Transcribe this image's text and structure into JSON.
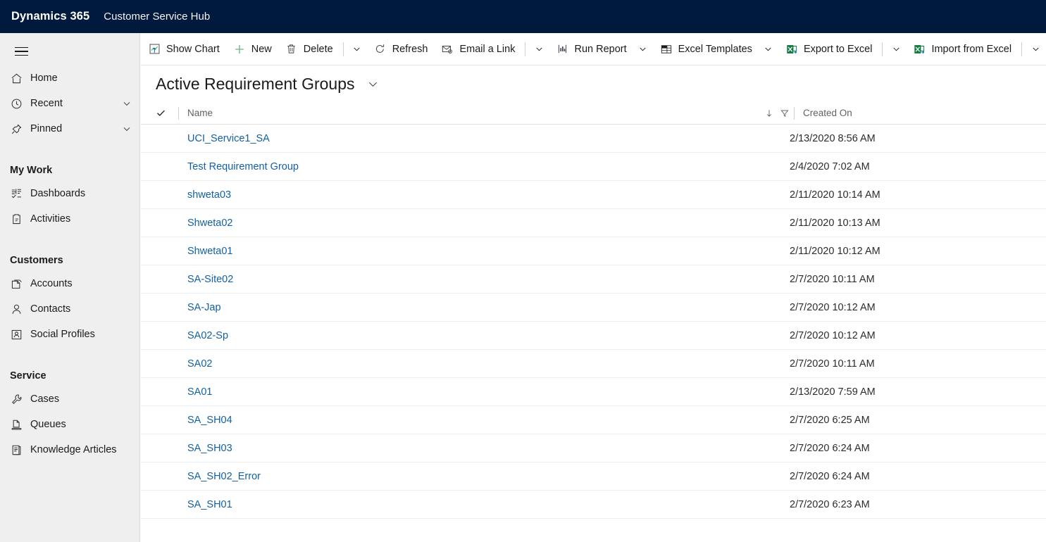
{
  "header": {
    "brand": "Dynamics 365",
    "app_name": "Customer Service Hub",
    "background_color": "#001a3d"
  },
  "sidebar": {
    "menu_toggle": "site-map-toggle",
    "top_items": [
      {
        "label": "Home",
        "icon": "home-icon",
        "expandable": false
      },
      {
        "label": "Recent",
        "icon": "clock-icon",
        "expandable": true
      },
      {
        "label": "Pinned",
        "icon": "pin-icon",
        "expandable": true
      }
    ],
    "groups": [
      {
        "title": "My Work",
        "items": [
          {
            "label": "Dashboards",
            "icon": "dashboard-icon"
          },
          {
            "label": "Activities",
            "icon": "activities-icon"
          }
        ]
      },
      {
        "title": "Customers",
        "items": [
          {
            "label": "Accounts",
            "icon": "accounts-icon"
          },
          {
            "label": "Contacts",
            "icon": "contact-icon"
          },
          {
            "label": "Social Profiles",
            "icon": "social-profile-icon"
          }
        ]
      },
      {
        "title": "Service",
        "items": [
          {
            "label": "Cases",
            "icon": "wrench-icon"
          },
          {
            "label": "Queues",
            "icon": "queue-icon"
          },
          {
            "label": "Knowledge Articles",
            "icon": "knowledge-article-icon"
          }
        ]
      }
    ]
  },
  "commandbar": {
    "buttons": [
      {
        "label": "Show Chart",
        "icon": "show-chart-icon"
      },
      {
        "label": "New",
        "icon": "plus-icon"
      },
      {
        "label": "Delete",
        "icon": "trash-icon"
      },
      {
        "label": "Refresh",
        "icon": "refresh-icon"
      },
      {
        "label": "Email a Link",
        "icon": "email-link-icon"
      },
      {
        "label": "Run Report",
        "icon": "run-report-icon"
      },
      {
        "label": "Excel Templates",
        "icon": "excel-templates-icon"
      },
      {
        "label": "Export to Excel",
        "icon": "excel-icon"
      },
      {
        "label": "Import from Excel",
        "icon": "excel-icon"
      }
    ],
    "overflow_icon": "more-commands-icon"
  },
  "view": {
    "title": "Active Requirement Groups",
    "selector_icon": "chevron-down-icon"
  },
  "grid": {
    "select_all_icon": "checkmark-icon",
    "columns": [
      {
        "key": "name",
        "label": "Name",
        "sorted": true,
        "sort_direction": "ascending",
        "sort_icon": "arrow-down-icon",
        "filter_icon": "filter-icon"
      },
      {
        "key": "created_on",
        "label": "Created On"
      }
    ],
    "rows": [
      {
        "name": "UCI_Service1_SA",
        "created_on": "2/13/2020 8:56 AM"
      },
      {
        "name": "Test Requirement Group",
        "created_on": "2/4/2020 7:02 AM"
      },
      {
        "name": "shweta03",
        "created_on": "2/11/2020 10:14 AM"
      },
      {
        "name": "Shweta02",
        "created_on": "2/11/2020 10:13 AM"
      },
      {
        "name": "Shweta01",
        "created_on": "2/11/2020 10:12 AM"
      },
      {
        "name": "SA-Site02",
        "created_on": "2/7/2020 10:11 AM"
      },
      {
        "name": "SA-Jap",
        "created_on": "2/7/2020 10:12 AM"
      },
      {
        "name": "SA02-Sp",
        "created_on": "2/7/2020 10:12 AM"
      },
      {
        "name": "SA02",
        "created_on": "2/7/2020 10:11 AM"
      },
      {
        "name": "SA01",
        "created_on": "2/13/2020 7:59 AM"
      },
      {
        "name": "SA_SH04",
        "created_on": "2/7/2020 6:25 AM"
      },
      {
        "name": "SA_SH03",
        "created_on": "2/7/2020 6:24 AM"
      },
      {
        "name": "SA_SH02_Error",
        "created_on": "2/7/2020 6:24 AM"
      },
      {
        "name": "SA_SH01",
        "created_on": "2/7/2020 6:23 AM"
      }
    ]
  },
  "colors": {
    "header_navy": "#001a3d",
    "link_blue": "#1160a8",
    "sidebar_gray": "#efefef",
    "accent_green": "#107c41"
  }
}
